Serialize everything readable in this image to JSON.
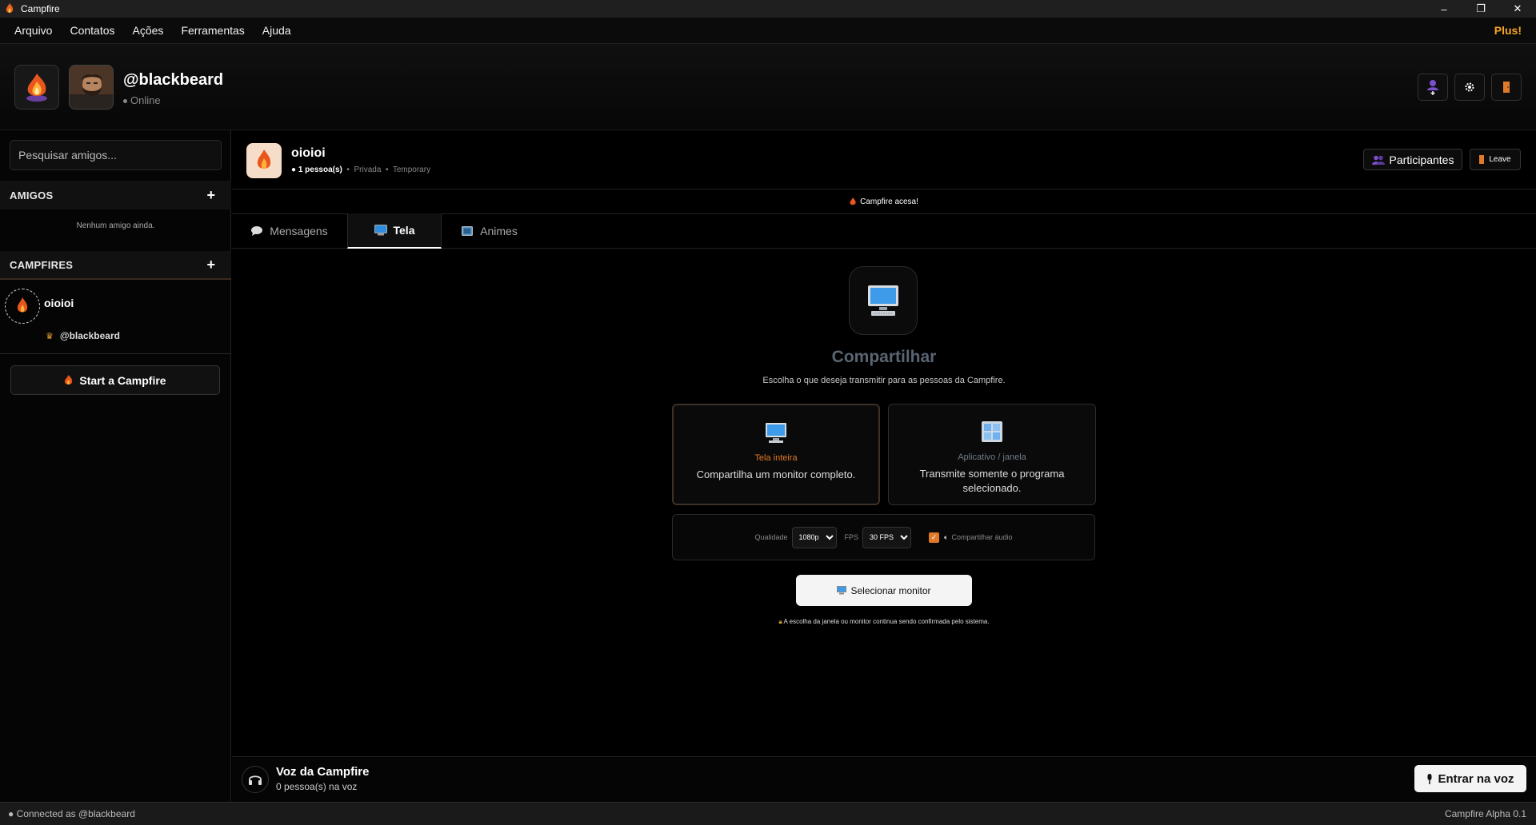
{
  "window": {
    "title": "Campfire",
    "minimize": "–",
    "restore": "❐",
    "close": "✕"
  },
  "menu": {
    "items": [
      "Arquivo",
      "Contatos",
      "Ações",
      "Ferramentas",
      "Ajuda"
    ],
    "plus_label": "Plus!"
  },
  "profile": {
    "username": "@blackbeard",
    "status": "Online"
  },
  "sidebar": {
    "search_placeholder": "Pesquisar amigos...",
    "friends_header": "AMIGOS",
    "friends_empty": "Nenhum amigo ainda.",
    "campfires_header": "CAMPFIRES",
    "add_symbol": "+",
    "campfire": {
      "name": "oioioi",
      "member": "@blackbeard"
    },
    "start_button": "Start a Campfire"
  },
  "chat": {
    "name": "oioioi",
    "count": "1 pessoa(s)",
    "privacy": "Privada",
    "mode": "Temporary",
    "participants_button": "Participantes",
    "leave_button": "Leave",
    "notice": "Campfire acesa!"
  },
  "tabs": [
    {
      "label": "Mensagens",
      "active": false
    },
    {
      "label": "Tela",
      "active": true
    },
    {
      "label": "Animes",
      "active": false
    }
  ],
  "share": {
    "title": "Compartilhar",
    "subtitle": "Escolha o que deseja transmitir para as pessoas da Campfire.",
    "options": [
      {
        "title": "Tela inteira",
        "description": "Compartilha um monitor completo.",
        "selected": true,
        "title_color": "#e07a2a"
      },
      {
        "title": "Aplicativo / janela",
        "description": "Transmite somente o programa selecionado.",
        "selected": false,
        "title_color": "#6e7a86"
      }
    ],
    "quality_label": "Qualidade",
    "quality_value": "1080p",
    "fps_label": "FPS",
    "fps_value": "30 FPS",
    "audio_label": "Compartilhar áudio",
    "audio_checked": true,
    "select_button": "Selecionar monitor",
    "footnote": "A escolha da janela ou monitor continua sendo confirmada pelo sistema."
  },
  "voice": {
    "title": "Voz da Campfire",
    "count": "0 pessoa(s) na voz",
    "join_button": "Entrar na voz"
  },
  "statusbar": {
    "left": "Connected as @blackbeard",
    "right": "Campfire Alpha 0.1"
  },
  "colors": {
    "accent": "#e07a2a",
    "plus": "#f5a623",
    "background": "#000000"
  }
}
